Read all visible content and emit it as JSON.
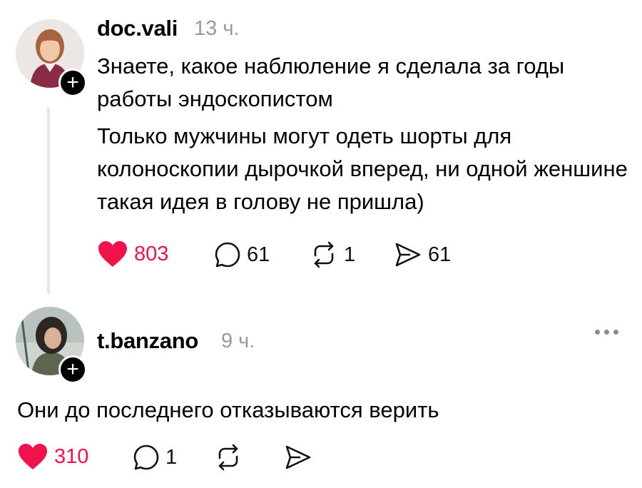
{
  "post": {
    "username": "doc.vali",
    "time": "13 ч.",
    "paragraphs": [
      "Знаете, какое наблюление я сделала за годы работы эндоскопистом",
      "Только мужчины могут одеть шорты для колоноскопии дырочкой вперед, ни одной женшине такая идея в голову не пришла)"
    ],
    "likes": "803",
    "comments": "61",
    "reposts": "1",
    "shares": "61",
    "follow_label": "+"
  },
  "reply": {
    "username": "t.banzano",
    "time": "9 ч.",
    "text": "Они до последнего отказываются верить",
    "likes": "310",
    "comments": "1",
    "follow_label": "+"
  },
  "colors": {
    "like": "#f0134b",
    "muted": "#9a9a9a",
    "thread_line": "#e6e6e6"
  },
  "icons": [
    "heart-icon",
    "comment-icon",
    "repost-icon",
    "share-icon",
    "more-icon",
    "plus-icon"
  ]
}
